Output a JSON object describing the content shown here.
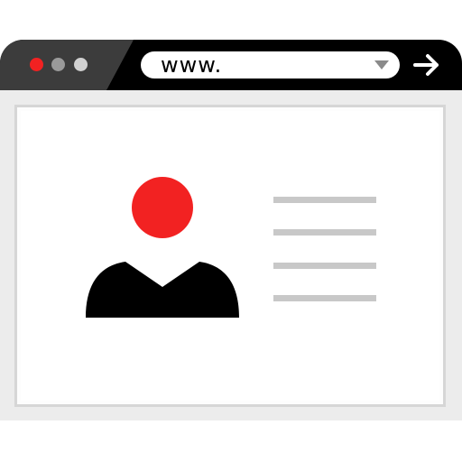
{
  "browser": {
    "address_bar": {
      "value": "www."
    },
    "window_controls": [
      {
        "name": "close",
        "color": "#f22222"
      },
      {
        "name": "minimize",
        "color": "#9a9a9a"
      },
      {
        "name": "maximize",
        "color": "#d0d0d0"
      }
    ],
    "icons": {
      "dropdown": "chevron-down-icon",
      "go": "arrow-right-icon"
    }
  },
  "profile": {
    "avatar_head_color": "#f22222",
    "avatar_body_color": "#000000",
    "detail_line_count": 4,
    "detail_line_color": "#c8c8c8"
  }
}
